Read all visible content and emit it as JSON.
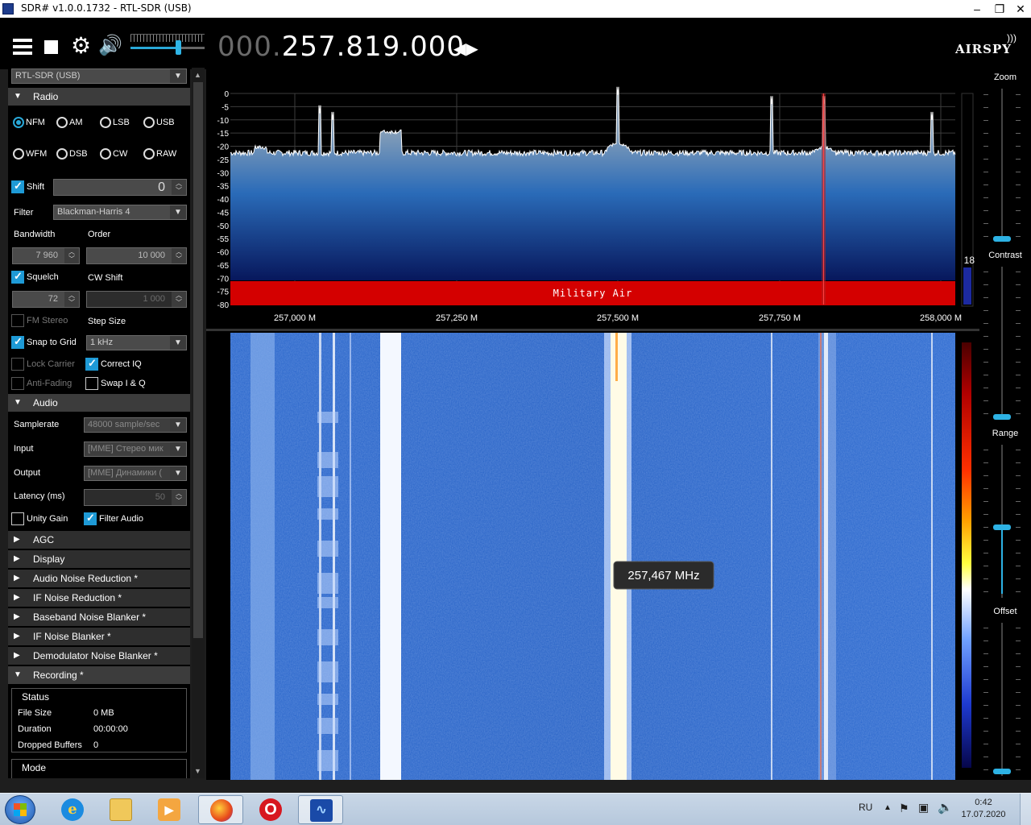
{
  "window": {
    "title": "SDR# v1.0.0.1732 - RTL-SDR (USB)",
    "minimize": "–",
    "maximize": "❐",
    "close": "✕"
  },
  "toolbar": {
    "freq_prefix": "000.",
    "freq_main": "257.819.000",
    "freq_arrows": "◀▶",
    "logo": "AIRSPY",
    "volume_level": 0.65
  },
  "left": {
    "device": "RTL-SDR (USB)",
    "sections": {
      "radio": "Radio",
      "audio": "Audio",
      "agc": "AGC",
      "display": "Display",
      "audio_nr": "Audio Noise Reduction *",
      "if_nr": "IF Noise Reduction *",
      "bb_blanker": "Baseband Noise Blanker *",
      "if_blanker": "IF Noise Blanker *",
      "demod_blanker": "Demodulator Noise Blanker *",
      "recording": "Recording *"
    },
    "modes": [
      "NFM",
      "AM",
      "LSB",
      "USB",
      "WFM",
      "DSB",
      "CW",
      "RAW"
    ],
    "selected_mode": "NFM",
    "shift_label": "Shift",
    "shift_value": "0",
    "filter_label": "Filter",
    "filter_value": "Blackman-Harris 4",
    "bandwidth_label": "Bandwidth",
    "order_label": "Order",
    "bandwidth_value": "7 960",
    "order_value": "10 000",
    "squelch_label": "Squelch",
    "cwshift_label": "CW Shift",
    "squelch_value": "72",
    "cwshift_value": "1 000",
    "fmstereo_label": "FM Stereo",
    "stepsize_label": "Step Size",
    "snap_label": "Snap to Grid",
    "step_value": "1 kHz",
    "lockcarrier_label": "Lock Carrier",
    "correctiq_label": "Correct IQ",
    "antifading_label": "Anti-Fading",
    "swapiq_label": "Swap I & Q",
    "samplerate_label": "Samplerate",
    "samplerate_value": "48000 sample/sec",
    "input_label": "Input",
    "input_value": "[MME] Стерео мик",
    "output_label": "Output",
    "output_value": "[MME] Динамики (",
    "latency_label": "Latency (ms)",
    "latency_value": "50",
    "unitygain_label": "Unity Gain",
    "filteraudio_label": "Filter Audio",
    "status_title": "Status",
    "filesize_label": "File Size",
    "filesize_value": "0 MB",
    "duration_label": "Duration",
    "duration_value": "00:00:00",
    "dropped_label": "Dropped Buffers",
    "dropped_value": "0",
    "mode_title": "Mode"
  },
  "spectrum": {
    "y_ticks": [
      "0",
      "-5",
      "-10",
      "-15",
      "-20",
      "-25",
      "-30",
      "-35",
      "-40",
      "-45",
      "-50",
      "-55",
      "-60",
      "-65",
      "-70",
      "-75",
      "-80"
    ],
    "x_ticks": [
      "257,000 M",
      "257,250 M",
      "257,500 M",
      "257,750 M",
      "258,000 M"
    ],
    "band_label": "Military Air",
    "squelch_level": "18",
    "tooltip": "257,467 MHz"
  },
  "right": {
    "zoom": "Zoom",
    "contrast": "Contrast",
    "range": "Range",
    "offset": "Offset"
  },
  "taskbar": {
    "lang": "RU",
    "time": "0:42",
    "date": "17.07.2020"
  }
}
